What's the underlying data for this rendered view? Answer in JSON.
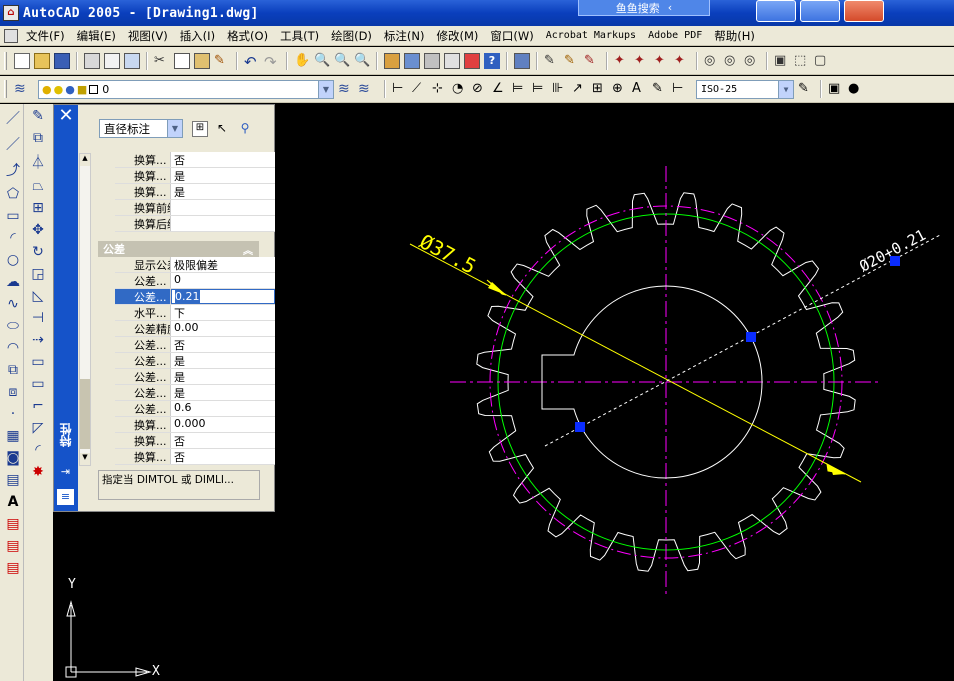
{
  "window": {
    "title": "AutoCAD 2005 - [Drawing1.dwg]",
    "search_label": "鱼鱼搜索"
  },
  "menu": [
    "文件(F)",
    "编辑(E)",
    "视图(V)",
    "插入(I)",
    "格式(O)",
    "工具(T)",
    "绘图(D)",
    "标注(N)",
    "修改(M)",
    "窗口(W)",
    "Acrobat Markups",
    "Adobe PDF",
    "帮助(H)"
  ],
  "layer": {
    "name": "0"
  },
  "dimstyle": {
    "value": "ISO-25"
  },
  "properties": {
    "selector": "直径标注",
    "rows_top": [
      {
        "k": "换算...",
        "v": "否"
      },
      {
        "k": "换算...",
        "v": "是"
      },
      {
        "k": "换算...",
        "v": "是"
      },
      {
        "k": "换算前缀",
        "v": ""
      },
      {
        "k": "换算后缀",
        "v": ""
      }
    ],
    "section_tolerance": "公差",
    "rows_tol": [
      {
        "k": "显示公差",
        "v": "极限偏差"
      },
      {
        "k": "公差...",
        "v": "0"
      },
      {
        "k": "公差...",
        "v": "0.21"
      },
      {
        "k": "水平...",
        "v": "下"
      },
      {
        "k": "公差精度",
        "v": "0.00"
      },
      {
        "k": "公差...",
        "v": "否"
      },
      {
        "k": "公差...",
        "v": "是"
      },
      {
        "k": "公差...",
        "v": "是"
      },
      {
        "k": "公差...",
        "v": "是"
      },
      {
        "k": "公差...",
        "v": "0.6"
      },
      {
        "k": "换算...",
        "v": "0.000"
      },
      {
        "k": "换算...",
        "v": "否"
      },
      {
        "k": "换算...",
        "v": "否"
      }
    ],
    "description": "指定当 DIMTOL 或 DIMLI...",
    "tab_label": "特性"
  },
  "drawing": {
    "dim_outer": "Ø37.5",
    "dim_inner": "Ø20+0.21",
    "ucs_x": "X",
    "ucs_y": "Y",
    "colors": {
      "gear": "#ffffff",
      "center": "#ff00ff",
      "pitch": "#00ff00",
      "dim": "#ffff00",
      "grip": "#0a2cff"
    }
  }
}
